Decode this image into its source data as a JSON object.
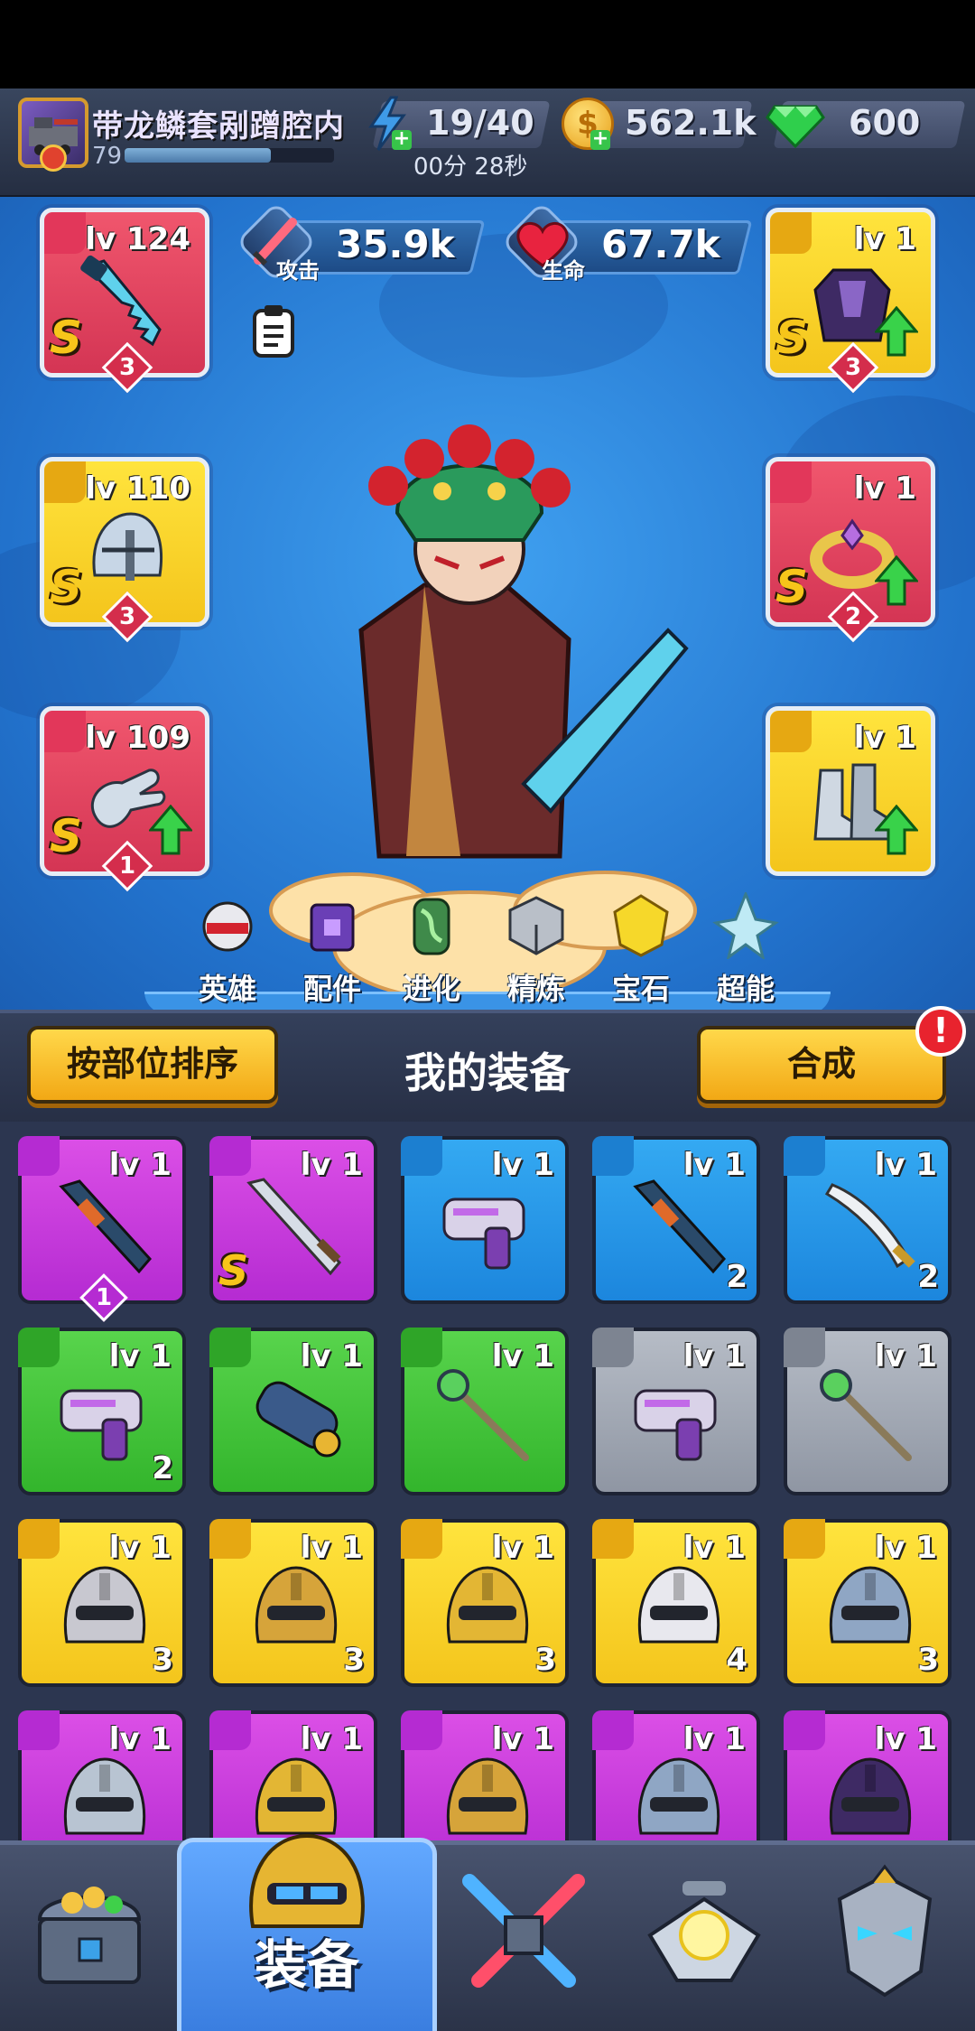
{
  "player": {
    "name": "带龙鳞套剐蹭腔内",
    "level": "79"
  },
  "resources": {
    "energy": "19/40",
    "energy_timer": "00分 28秒",
    "coins": "562.1k",
    "gems": "600"
  },
  "stats": {
    "attack_value": "35.9k",
    "attack_label": "攻击",
    "hp_value": "67.7k",
    "hp_label": "生命"
  },
  "equipped": [
    {
      "slot": "weapon",
      "level": "lv 124",
      "grade": "S",
      "stars": "3",
      "color": "red",
      "upgradable": false
    },
    {
      "slot": "helmet",
      "level": "lv 110",
      "grade": "S",
      "stars": "3",
      "color": "yellow",
      "upgradable": false
    },
    {
      "slot": "gloves",
      "level": "lv 109",
      "grade": "S",
      "stars": "1",
      "color": "red",
      "upgradable": true
    },
    {
      "slot": "armor",
      "level": "lv 1",
      "grade": "S",
      "stars": "3",
      "color": "yellow",
      "upgradable": true
    },
    {
      "slot": "ring",
      "level": "lv 1",
      "grade": "S",
      "stars": "2",
      "color": "red",
      "upgradable": true
    },
    {
      "slot": "boots",
      "level": "lv 1",
      "grade": "",
      "stars": "",
      "color": "yellow",
      "upgradable": true
    }
  ],
  "tabs": [
    {
      "label": "英雄",
      "icon": "hero-icon"
    },
    {
      "label": "配件",
      "icon": "accessory-icon"
    },
    {
      "label": "进化",
      "icon": "evolve-icon"
    },
    {
      "label": "精炼",
      "icon": "refine-icon"
    },
    {
      "label": "宝石",
      "icon": "gem-icon"
    },
    {
      "label": "超能",
      "icon": "superpower-icon"
    }
  ],
  "inventory": {
    "sort_button": "按部位排序",
    "title": "我的装备",
    "merge_button": "合成",
    "merge_alert": "!",
    "items": [
      {
        "color": "purple",
        "level": "lv 1",
        "count": "",
        "stars": "1",
        "grade": "",
        "icon": "bat-icon"
      },
      {
        "color": "purple",
        "level": "lv 1",
        "count": "",
        "stars": "",
        "grade": "S",
        "icon": "sword-icon"
      },
      {
        "color": "blue",
        "level": "lv 1",
        "count": "",
        "stars": "",
        "grade": "",
        "icon": "blaster-icon"
      },
      {
        "color": "blue",
        "level": "lv 1",
        "count": "2",
        "stars": "",
        "grade": "",
        "icon": "bat-icon"
      },
      {
        "color": "blue",
        "level": "lv 1",
        "count": "2",
        "stars": "",
        "grade": "",
        "icon": "scimitar-icon"
      },
      {
        "color": "green",
        "level": "lv 1",
        "count": "2",
        "stars": "",
        "grade": "",
        "icon": "blaster-icon"
      },
      {
        "color": "green",
        "level": "lv 1",
        "count": "",
        "stars": "",
        "grade": "",
        "icon": "cannon-icon"
      },
      {
        "color": "green",
        "level": "lv 1",
        "count": "",
        "stars": "",
        "grade": "",
        "icon": "staff-icon"
      },
      {
        "color": "gray",
        "level": "lv 1",
        "count": "",
        "stars": "",
        "grade": "",
        "icon": "blaster-icon"
      },
      {
        "color": "gray",
        "level": "lv 1",
        "count": "",
        "stars": "",
        "grade": "",
        "icon": "staff-icon"
      },
      {
        "color": "yellow",
        "level": "lv 1",
        "count": "3",
        "stars": "",
        "grade": "",
        "icon": "helmet-icon"
      },
      {
        "color": "yellow",
        "level": "lv 1",
        "count": "3",
        "stars": "",
        "grade": "",
        "icon": "helmet-icon"
      },
      {
        "color": "yellow",
        "level": "lv 1",
        "count": "3",
        "stars": "",
        "grade": "",
        "icon": "helmet-icon"
      },
      {
        "color": "yellow",
        "level": "lv 1",
        "count": "4",
        "stars": "",
        "grade": "",
        "icon": "helmet-icon"
      },
      {
        "color": "yellow",
        "level": "lv 1",
        "count": "3",
        "stars": "",
        "grade": "",
        "icon": "helmet-icon"
      },
      {
        "color": "purple",
        "level": "lv 1",
        "count": "",
        "stars": "",
        "grade": "",
        "icon": "helmet-icon"
      },
      {
        "color": "purple",
        "level": "lv 1",
        "count": "",
        "stars": "",
        "grade": "",
        "icon": "helmet-icon"
      },
      {
        "color": "purple",
        "level": "lv 1",
        "count": "",
        "stars": "",
        "grade": "",
        "icon": "helmet-icon"
      },
      {
        "color": "purple",
        "level": "lv 1",
        "count": "",
        "stars": "",
        "grade": "",
        "icon": "helmet-icon"
      },
      {
        "color": "purple",
        "level": "lv 1",
        "count": "",
        "stars": "",
        "grade": "",
        "icon": "helmet-icon"
      }
    ]
  },
  "bottom_nav": [
    {
      "icon": "treasure-chest-icon",
      "label": ""
    },
    {
      "icon": "gold-helmet-icon",
      "label": "装备",
      "active": true
    },
    {
      "icon": "crossed-swords-icon",
      "label": ""
    },
    {
      "icon": "spaceship-icon",
      "label": ""
    },
    {
      "icon": "armored-mask-icon",
      "label": ""
    }
  ],
  "colors": {
    "red": "#e24661",
    "yellow": "#f8d22c",
    "purple": "#c83ddc",
    "blue": "#2897e8",
    "green": "#45c43c",
    "gray": "#a3a9b4",
    "accent": "#f4b81f"
  }
}
